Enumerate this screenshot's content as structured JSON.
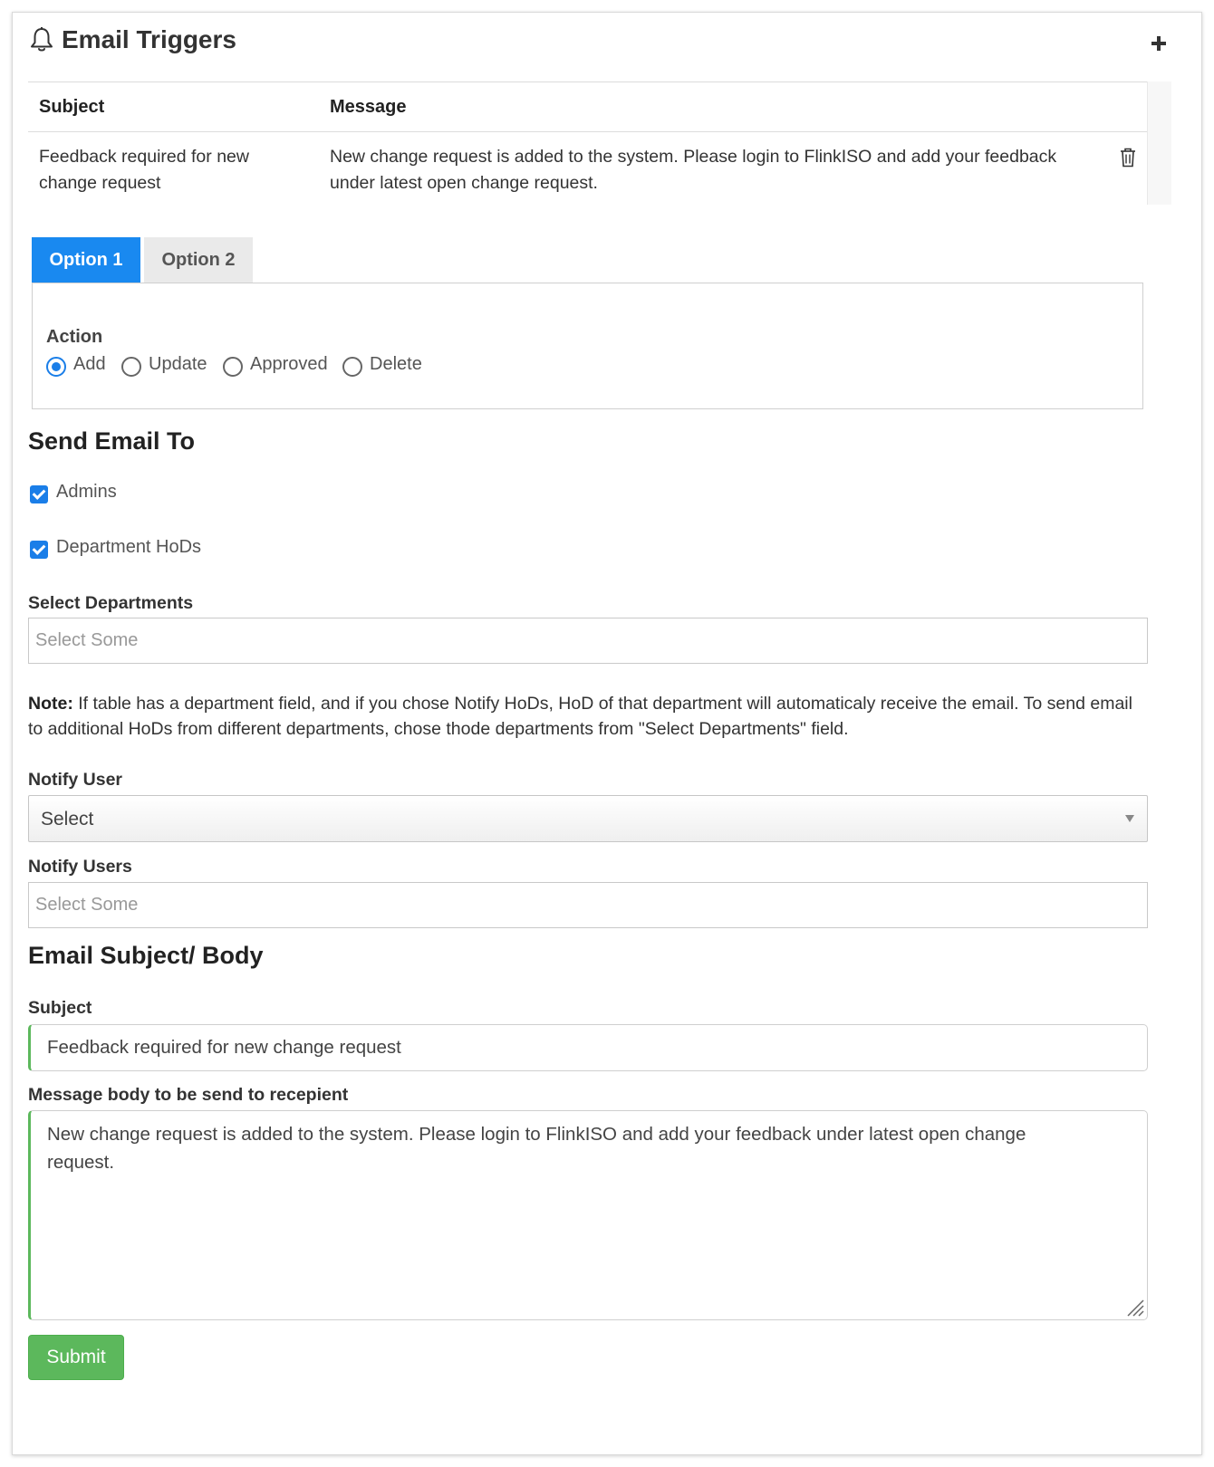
{
  "panel": {
    "title": "Email Triggers",
    "icon": "bell-icon",
    "add_icon": "plus-icon"
  },
  "triggers_table": {
    "columns": [
      "Subject",
      "Message"
    ],
    "rows": [
      {
        "subject": "Feedback required for new change request",
        "message": "New change request is added to the system. Please login to FlinkISO and add your feedback under latest open change request.",
        "action_icon": "trash-icon"
      }
    ]
  },
  "tabs": [
    {
      "label": "Option 1",
      "active": true
    },
    {
      "label": "Option 2",
      "active": false
    }
  ],
  "action": {
    "label": "Action",
    "options": [
      "Add",
      "Update",
      "Approved",
      "Delete"
    ],
    "selected": "Add"
  },
  "send_email_to": {
    "heading": "Send Email To",
    "admins_label": "Admins",
    "admins_checked": true,
    "hods_label": "Department HoDs",
    "hods_checked": true
  },
  "select_departments": {
    "label": "Select Departments",
    "placeholder": "Select Some"
  },
  "note": {
    "prefix": "Note:",
    "text": " If table has a department field, and if you chose Notify HoDs, HoD of that department will automaticaly receive the email. To send email to additional HoDs from different departments, chose thode departments from \"Select Departments\" field."
  },
  "notify_user": {
    "label": "Notify User",
    "value": "Select"
  },
  "notify_users": {
    "label": "Notify Users",
    "placeholder": "Select Some"
  },
  "email": {
    "heading": "Email Subject/ Body",
    "subject_label": "Subject",
    "subject_value": "Feedback required for new change request",
    "body_label": "Message body to be send to recepient",
    "body_value": "New change request is added to the system. Please login to FlinkISO and add your feedback under latest open change request."
  },
  "submit_label": "Submit",
  "colors": {
    "primary": "#1989f0",
    "success": "#5cb85c",
    "tab_inactive": "#eaeaea"
  }
}
